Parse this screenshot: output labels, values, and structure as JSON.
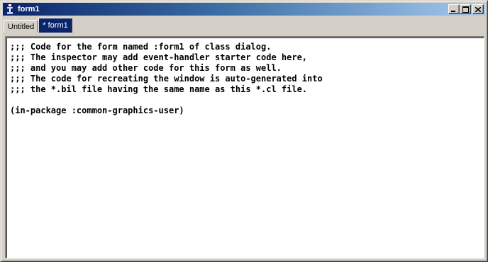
{
  "window": {
    "title": "form1",
    "icon": "lisp-app-icon",
    "buttons": [
      "minimize-icon",
      "maximize-icon",
      "close-icon"
    ]
  },
  "tabs": [
    {
      "label": "Untitled",
      "active": false
    },
    {
      "label": "* form1",
      "active": true
    }
  ],
  "editor": {
    "lines": [
      ";;; Code for the form named :form1 of class dialog.",
      ";;; The inspector may add event-handler starter code here,",
      ";;; and you may add other code for this form as well.",
      ";;; The code for recreating the window is auto-generated into",
      ";;; the *.bil file having the same name as this *.cl file.",
      "",
      "(in-package :common-graphics-user)"
    ]
  },
  "colors": {
    "titlebar_start": "#0a246a",
    "titlebar_end": "#a6caf0",
    "active_tab": "#0a246a",
    "face": "#d4d0c8"
  }
}
